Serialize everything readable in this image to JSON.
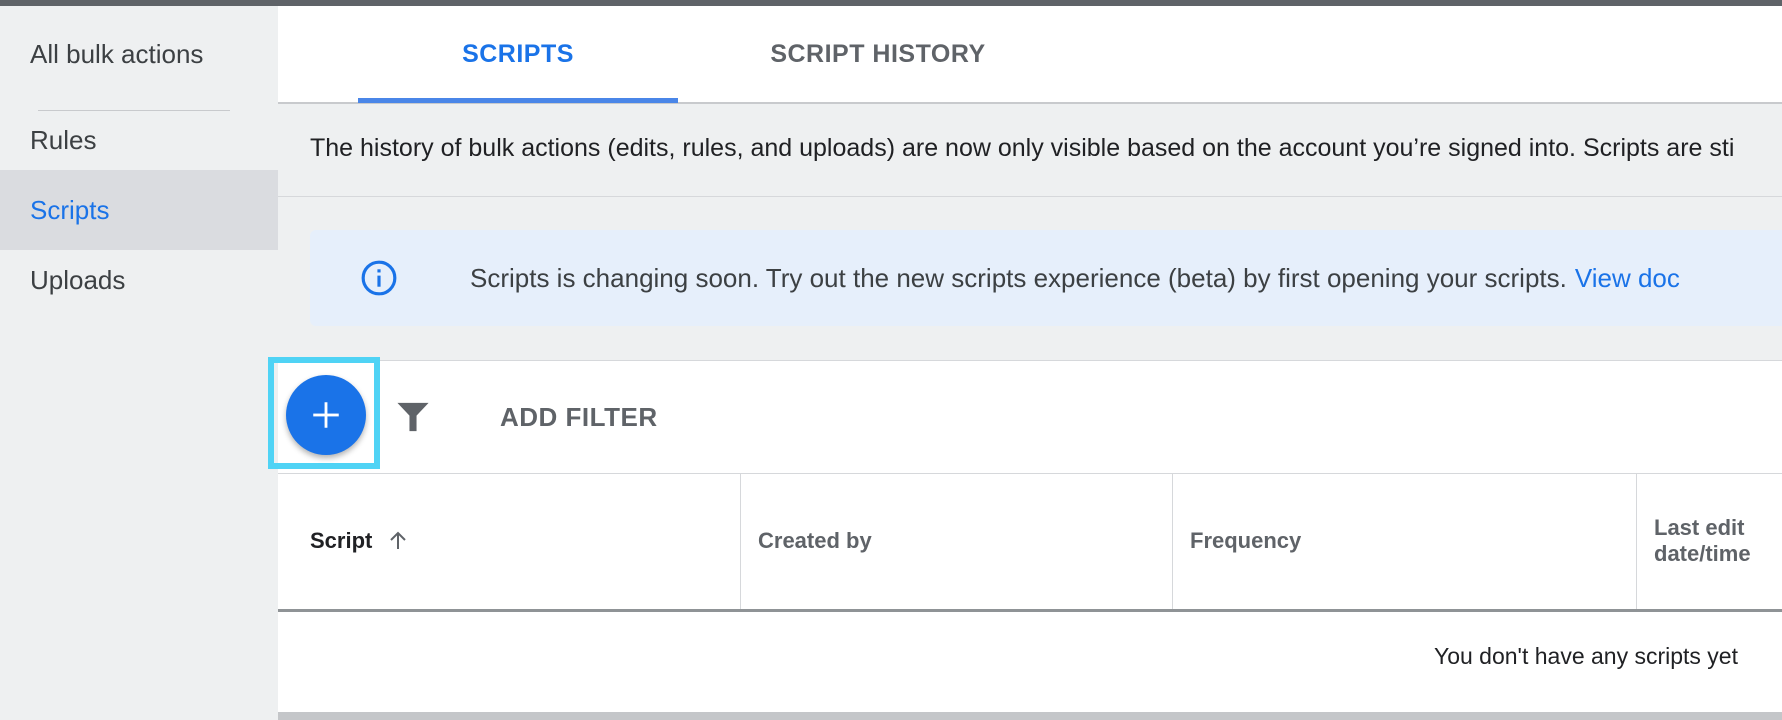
{
  "sidebar": {
    "items": [
      {
        "label": "All bulk actions"
      },
      {
        "label": "Rules"
      },
      {
        "label": "Scripts"
      },
      {
        "label": "Uploads"
      }
    ],
    "active_item": "Scripts"
  },
  "tabs": [
    {
      "label": "SCRIPTS",
      "active": true
    },
    {
      "label": "SCRIPT HISTORY",
      "active": false
    }
  ],
  "history_notice": "The history of bulk actions (edits, rules, and uploads) are now only visible based on the account you’re signed into. Scripts are sti",
  "info_banner": {
    "icon": "info-icon",
    "text": "Scripts is changing soon. Try out the new scripts experience (beta) by first opening your scripts.",
    "link_text": "View doc"
  },
  "toolbar": {
    "add_icon": "plus-icon",
    "filter_icon": "filter-icon",
    "add_filter_label": "ADD FILTER"
  },
  "table": {
    "columns": [
      {
        "label": "Script",
        "sorted": "ascending"
      },
      {
        "label": "Created by"
      },
      {
        "label": "Frequency"
      },
      {
        "label": "Last edit date/time"
      }
    ],
    "empty_message": "You don't have any scripts yet"
  },
  "colors": {
    "accent": "#1a73e8",
    "highlight": "#4fd3f5",
    "banner_bg": "#e6effb"
  }
}
